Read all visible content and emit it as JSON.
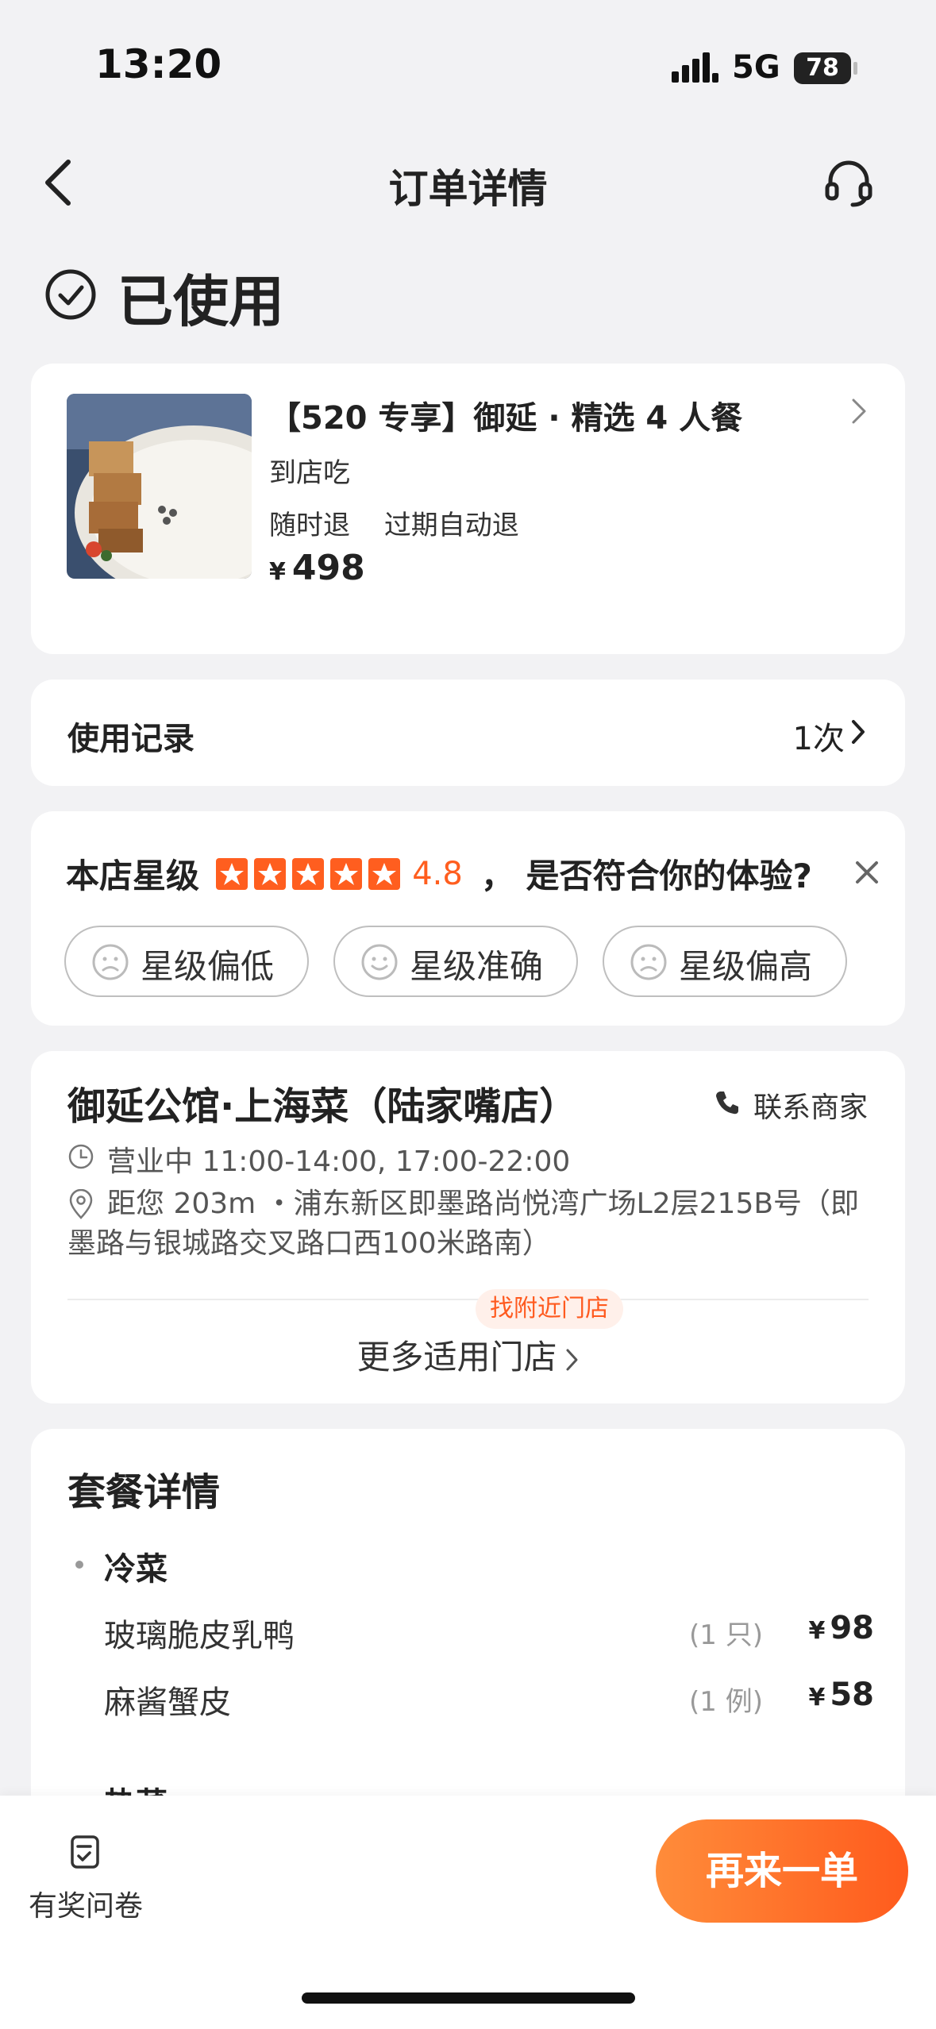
{
  "status_bar": {
    "time": "13:20",
    "network": "5G",
    "battery": "78"
  },
  "navbar": {
    "title": "订单详情",
    "back_icon": "chevron-left-icon",
    "service_icon": "headset-icon"
  },
  "order_status": {
    "text": "已使用",
    "icon": "check-circle-icon"
  },
  "product": {
    "title": "【520 专享】御延 · 精选 4 人餐",
    "tag": "到店吃",
    "policy": [
      "随时退",
      "过期自动退"
    ],
    "currency": "¥",
    "price": "498"
  },
  "usage": {
    "label": "使用记录",
    "count": "1次"
  },
  "rating": {
    "label": "本店星级",
    "stars": 5,
    "score": "4.8",
    "question": "，  是否符合你的体验?",
    "options": [
      {
        "label": "星级偏低",
        "icon": "sad-face-icon"
      },
      {
        "label": "星级准确",
        "icon": "smile-face-icon"
      },
      {
        "label": "星级偏高",
        "icon": "sad-face-icon"
      }
    ],
    "accent": "#ff5e1f"
  },
  "store": {
    "name": "御延公馆·上海菜（陆家嘴店）",
    "contact": "联系商家",
    "hours": "营业中 11:00-14:00, 17:00-22:00",
    "address": "距您 203m ・浦东新区即墨路尚悦湾广场L2层215B号（即墨路与银城路交叉路口西100米路南）",
    "nearby_tag": "找附近门店",
    "more_stores": "更多适用门店"
  },
  "package": {
    "title": "套餐详情",
    "categories": [
      {
        "name": "冷菜",
        "items": [
          {
            "name": "玻璃脆皮乳鸭",
            "qty": "(1 只)",
            "currency": "¥",
            "price": "98"
          },
          {
            "name": "麻酱蟹皮",
            "qty": "(1 例)",
            "currency": "¥",
            "price": "58"
          }
        ]
      },
      {
        "name": "热菜",
        "items": []
      }
    ]
  },
  "bottom": {
    "survey": "有奖问卷",
    "reorder": "再来一单",
    "brand_color": "#ff6a24"
  }
}
